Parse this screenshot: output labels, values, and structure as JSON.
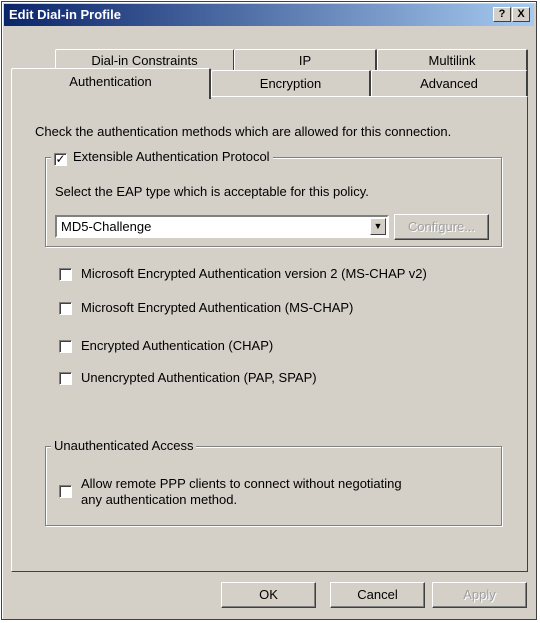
{
  "window": {
    "title": "Edit Dial-in Profile",
    "help_label": "?",
    "close_label": "X"
  },
  "tabs": {
    "row1": [
      "Dial-in Constraints",
      "IP",
      "Multilink"
    ],
    "row2": [
      "Authentication",
      "Encryption",
      "Advanced"
    ],
    "active": "Authentication"
  },
  "auth": {
    "intro": "Check the authentication methods which are allowed for this connection.",
    "eap": {
      "label": "Extensible Authentication Protocol",
      "checked": true,
      "select_prompt": "Select the EAP type which is acceptable for this policy.",
      "selected_type": "MD5-Challenge",
      "configure_label": "Configure..."
    },
    "methods": [
      {
        "label": "Microsoft Encrypted Authentication version 2 (MS-CHAP v2)",
        "checked": false
      },
      {
        "label": "Microsoft Encrypted Authentication (MS-CHAP)",
        "checked": false
      },
      {
        "label": "Encrypted Authentication (CHAP)",
        "checked": false
      },
      {
        "label": "Unencrypted Authentication (PAP, SPAP)",
        "checked": false
      }
    ],
    "unauth": {
      "legend": "Unauthenticated Access",
      "line1": "Allow remote PPP clients to connect without negotiating",
      "line2": "any authentication method.",
      "checked": false
    }
  },
  "buttons": {
    "ok": "OK",
    "cancel": "Cancel",
    "apply": "Apply"
  }
}
